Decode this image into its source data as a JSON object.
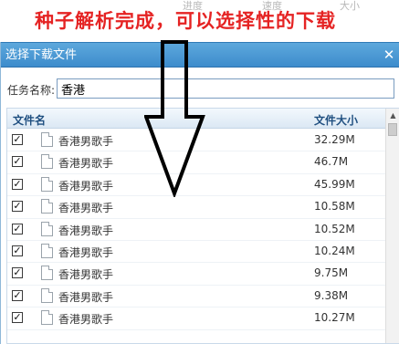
{
  "annotation": "种子解析完成，可以选择性的下载",
  "background_tabs": [
    "进度",
    "速度",
    "大小"
  ],
  "dialog": {
    "title": "选择下载文件",
    "task_label": "任务名称:",
    "task_value": "香港"
  },
  "table": {
    "headers": {
      "name": "文件名",
      "size": "文件大小"
    },
    "rows": [
      {
        "checked": true,
        "name": "香港男歌手",
        "size": "32.29M"
      },
      {
        "checked": true,
        "name": "香港男歌手",
        "size": "46.7M"
      },
      {
        "checked": true,
        "name": "香港男歌手",
        "size": "45.99M"
      },
      {
        "checked": true,
        "name": "香港男歌手",
        "size": "10.58M"
      },
      {
        "checked": true,
        "name": "香港男歌手",
        "size": "10.52M"
      },
      {
        "checked": true,
        "name": "香港男歌手",
        "size": "10.24M"
      },
      {
        "checked": true,
        "name": "香港男歌手",
        "size": "9.75M"
      },
      {
        "checked": true,
        "name": "香港男歌手",
        "size": "9.38M"
      },
      {
        "checked": true,
        "name": "香港男歌手",
        "size": "10.27M"
      }
    ]
  },
  "icons": {
    "close": "close-icon",
    "file": "file-icon",
    "checkbox": "checkbox-checked-icon",
    "arrow": "down-arrow-annotation"
  },
  "colors": {
    "annotation": "#e52323",
    "titlebar": "#3d8ccc",
    "header_text": "#1f4f80"
  }
}
